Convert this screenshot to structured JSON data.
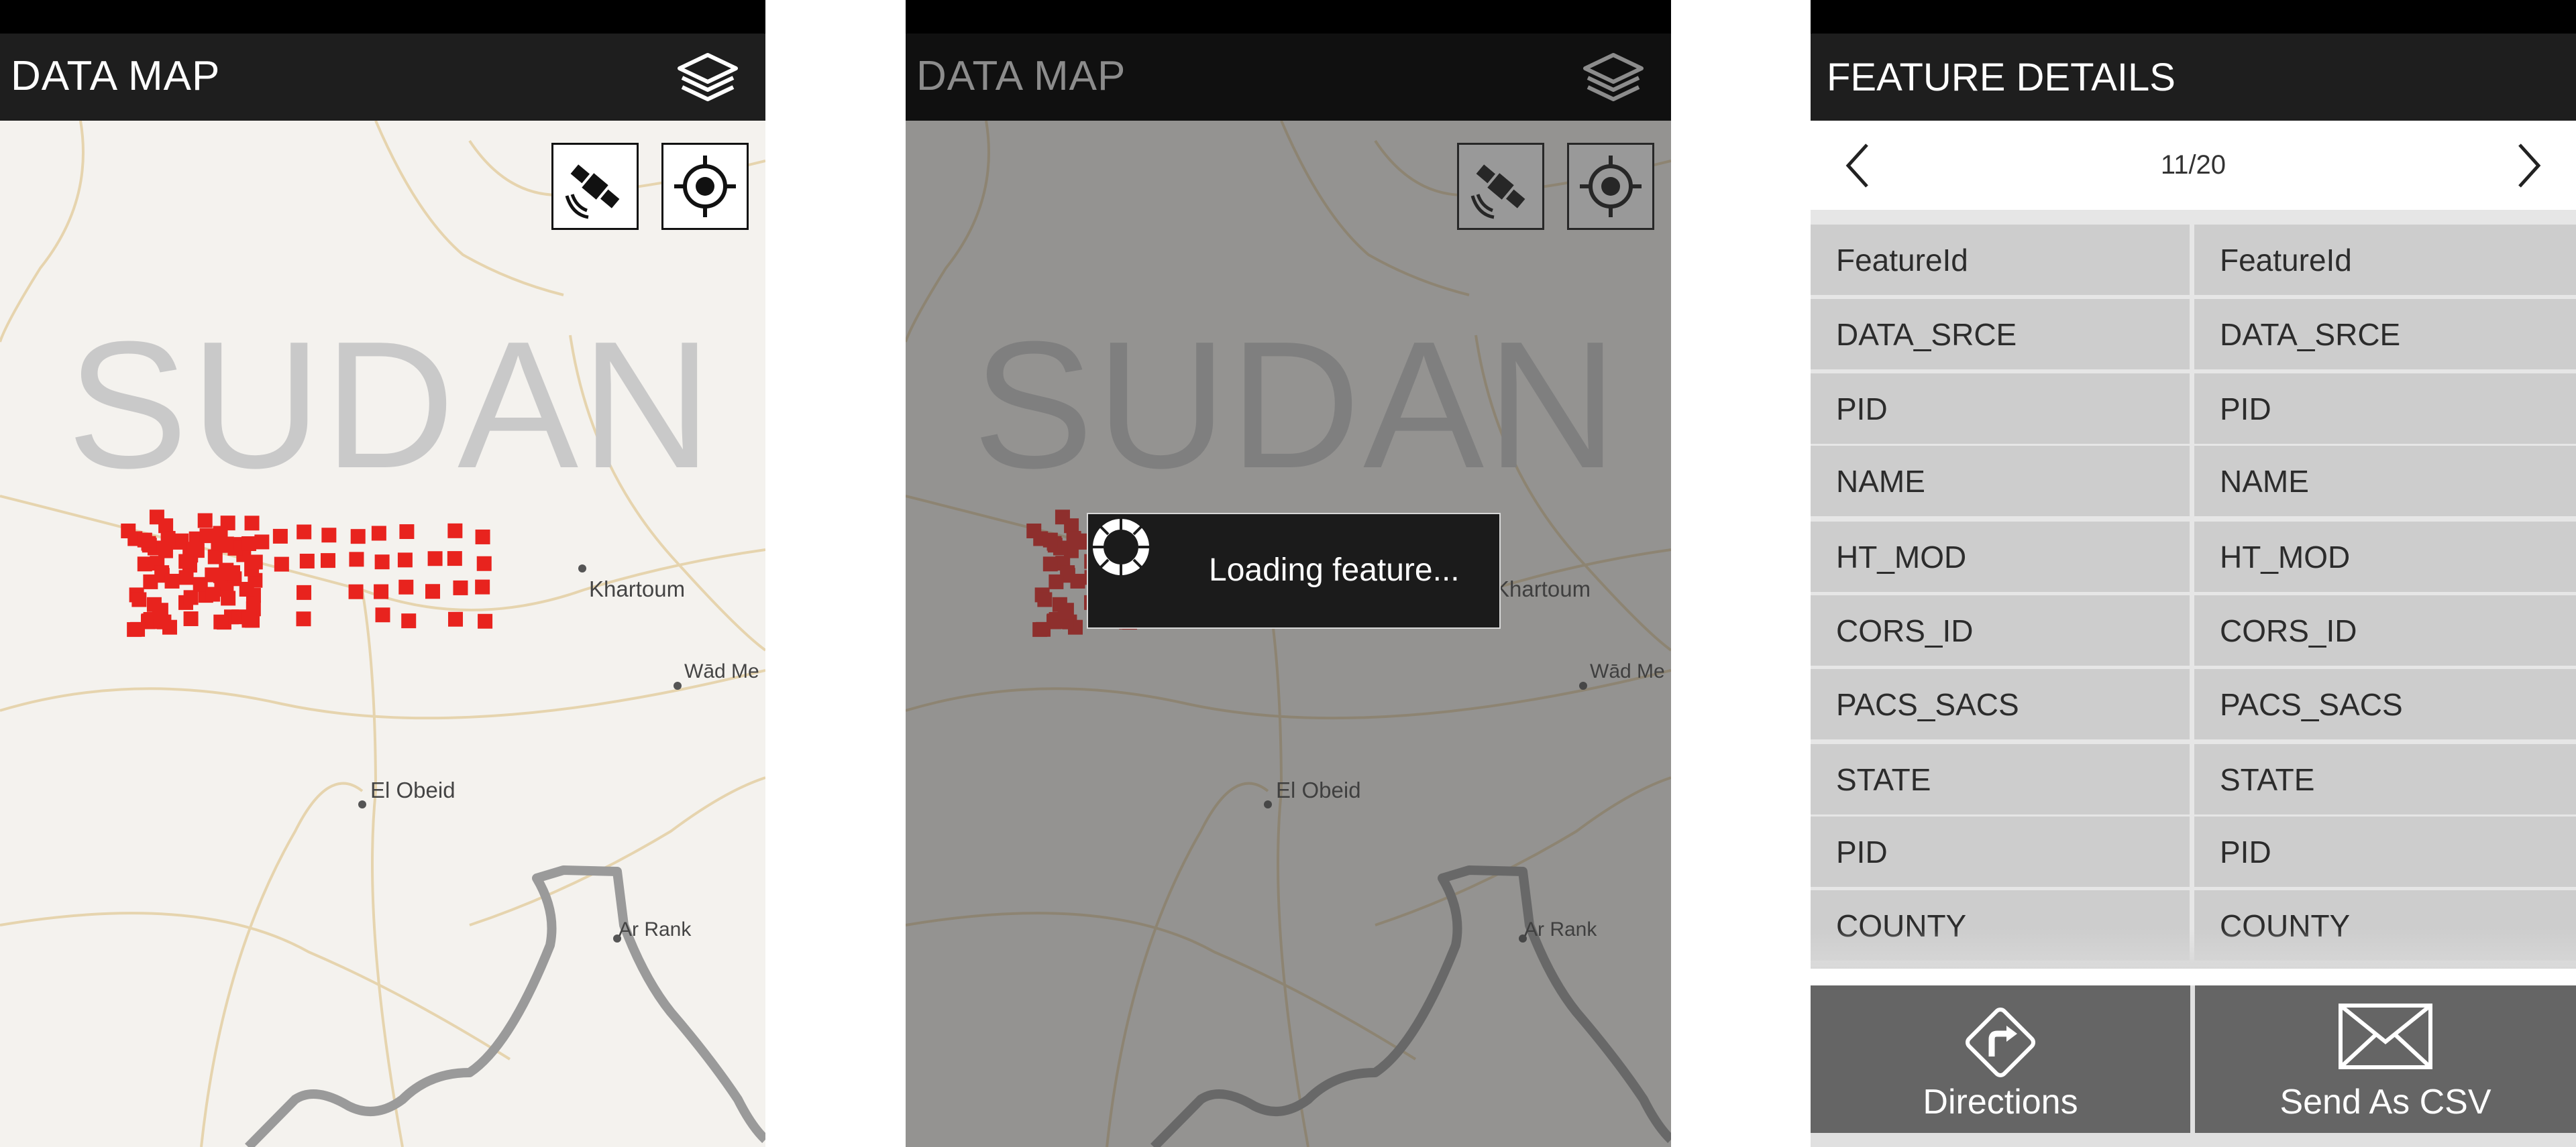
{
  "screens": [
    {
      "app_title": "DATA MAP",
      "country_label": "SUDAN",
      "cities": [
        "Khartoum",
        "Wād Me",
        "El Obeid",
        "Ar Rank"
      ]
    },
    {
      "app_title": "DATA MAP",
      "country_label": "SUDAN",
      "cities": [
        "Khartoum",
        "Wād Me",
        "El Obeid",
        "Ar Rank"
      ],
      "loading_text": "Loading feature..."
    },
    {
      "title": "FEATURE DETAILS",
      "pager": "11/20",
      "rows": [
        {
          "key": "FeatureId",
          "value": "FeatureId"
        },
        {
          "key": "DATA_SRCE",
          "value": "DATA_SRCE"
        },
        {
          "key": "PID",
          "value": "PID"
        },
        {
          "key": "NAME",
          "value": "NAME"
        },
        {
          "key": "HT_MOD",
          "value": "HT_MOD"
        },
        {
          "key": "CORS_ID",
          "value": "CORS_ID"
        },
        {
          "key": "PACS_SACS",
          "value": "PACS_SACS"
        },
        {
          "key": "STATE",
          "value": "STATE"
        },
        {
          "key": "PID",
          "value": "PID"
        },
        {
          "key": "COUNTY",
          "value": "COUNTY"
        }
      ],
      "actions": {
        "directions": "Directions",
        "send_csv": "Send As CSV"
      }
    }
  ],
  "colors": {
    "marker": "#e8231e",
    "appbar": "#1e1e1e",
    "action_bg": "#656565",
    "cell_bg": "#cdcdcd"
  },
  "icons": [
    "layers-icon",
    "satellite-icon",
    "locate-icon",
    "spinner-icon",
    "chevron-left-icon",
    "chevron-right-icon",
    "directions-icon",
    "envelope-icon"
  ]
}
